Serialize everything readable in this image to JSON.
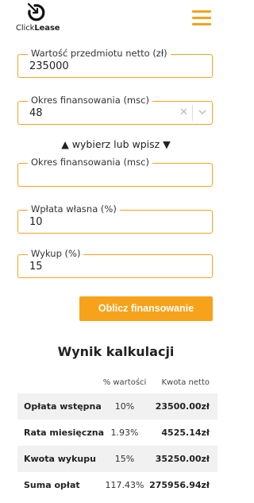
{
  "header": {
    "logo_text_regular": "Click",
    "logo_text_bold": "Lease",
    "menu_icon": "hamburger-menu-icon",
    "accent_color": "#f7a21b"
  },
  "form": {
    "net_value": {
      "label": "Wartość przedmiotu netto (zł)",
      "value": "235000"
    },
    "financing_period_select": {
      "label": "Okres finansowania (msc)",
      "value": "48"
    },
    "choose_hint": "▲ wybierz lub wpisz ▼",
    "financing_period_input": {
      "label": "Okres finansowania (msc)",
      "value": ""
    },
    "down_payment": {
      "label": "Wpłata własna (%)",
      "value": "10"
    },
    "buyout": {
      "label": "Wykup (%)",
      "value": "15"
    },
    "calculate_button": "Oblicz finansowanie"
  },
  "result": {
    "title": "Wynik kalkulacji",
    "columns": [
      "",
      "% wartości",
      "Kwota netto"
    ],
    "rows": [
      {
        "label": "Opłata wstępna",
        "percent": "10%",
        "amount": "23500.00zł"
      },
      {
        "label": "Rata miesięczna",
        "percent": "1.93%",
        "amount": "4525.14zł"
      },
      {
        "label": "Kwota wykupu",
        "percent": "15%",
        "amount": "35250.00zł"
      },
      {
        "label": "Suma opłat",
        "percent": "117.43%",
        "amount": "275956.94zł"
      }
    ]
  }
}
